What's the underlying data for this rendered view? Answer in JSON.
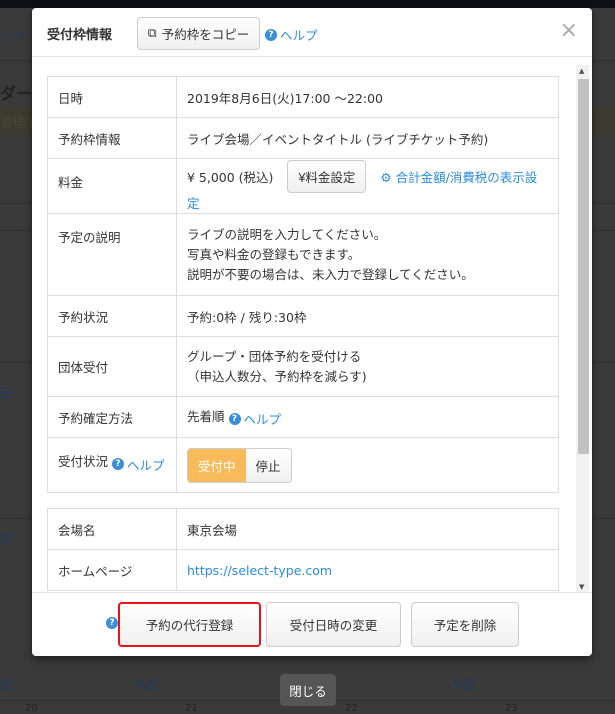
{
  "background": {
    "tab_fragment": "デザ",
    "title_fragment": "ダー",
    "notice_fragment": "管理す",
    "day_numbers": [
      "20",
      "21",
      "22",
      "23"
    ]
  },
  "modal": {
    "title": "受付枠情報",
    "copy_button": "予約枠をコピー",
    "help": "ヘルプ",
    "close": "×",
    "info_rows": [
      {
        "label": "日時",
        "value": "2019年8月6日(火)17:00 ～22:00"
      },
      {
        "label": "予約枠情報",
        "value": "ライブ会場／イベントタイトル (ライブチケット予約)"
      },
      {
        "label": "料金",
        "value": "¥ 5,000 (税込)",
        "button": "¥料金設定",
        "link": "合計金額/消費税の表示設定"
      },
      {
        "label": "予定の説明",
        "lines": [
          "ライブの説明を入力してください。",
          "写真や料金の登録もできます。",
          "説明が不要の場合は、未入力で登録してください。"
        ]
      },
      {
        "label": "予約状況",
        "value": "予約:0枠 / 残り:30枠"
      },
      {
        "label": "団体受付",
        "lines": [
          "グループ・団体予約を受付ける",
          "（申込人数分、予約枠を減らす)"
        ]
      },
      {
        "label": "予約確定方法",
        "value": "先着順",
        "help": "ヘルプ"
      },
      {
        "label": "受付状況",
        "help": "ヘルプ",
        "toggle": {
          "active": "受付中",
          "inactive": "停止",
          "selected": "受付中"
        }
      }
    ],
    "venue_rows": [
      {
        "label": "会場名",
        "value": "東京会場"
      },
      {
        "label": "ホームページ",
        "value": "https://select-type.com"
      }
    ],
    "footer": {
      "proxy_button": "予約の代行登録",
      "change_button": "受付日時の変更",
      "delete_button": "予定を削除"
    },
    "highlight_color": "#e8141b"
  },
  "close_label": "閉じる"
}
